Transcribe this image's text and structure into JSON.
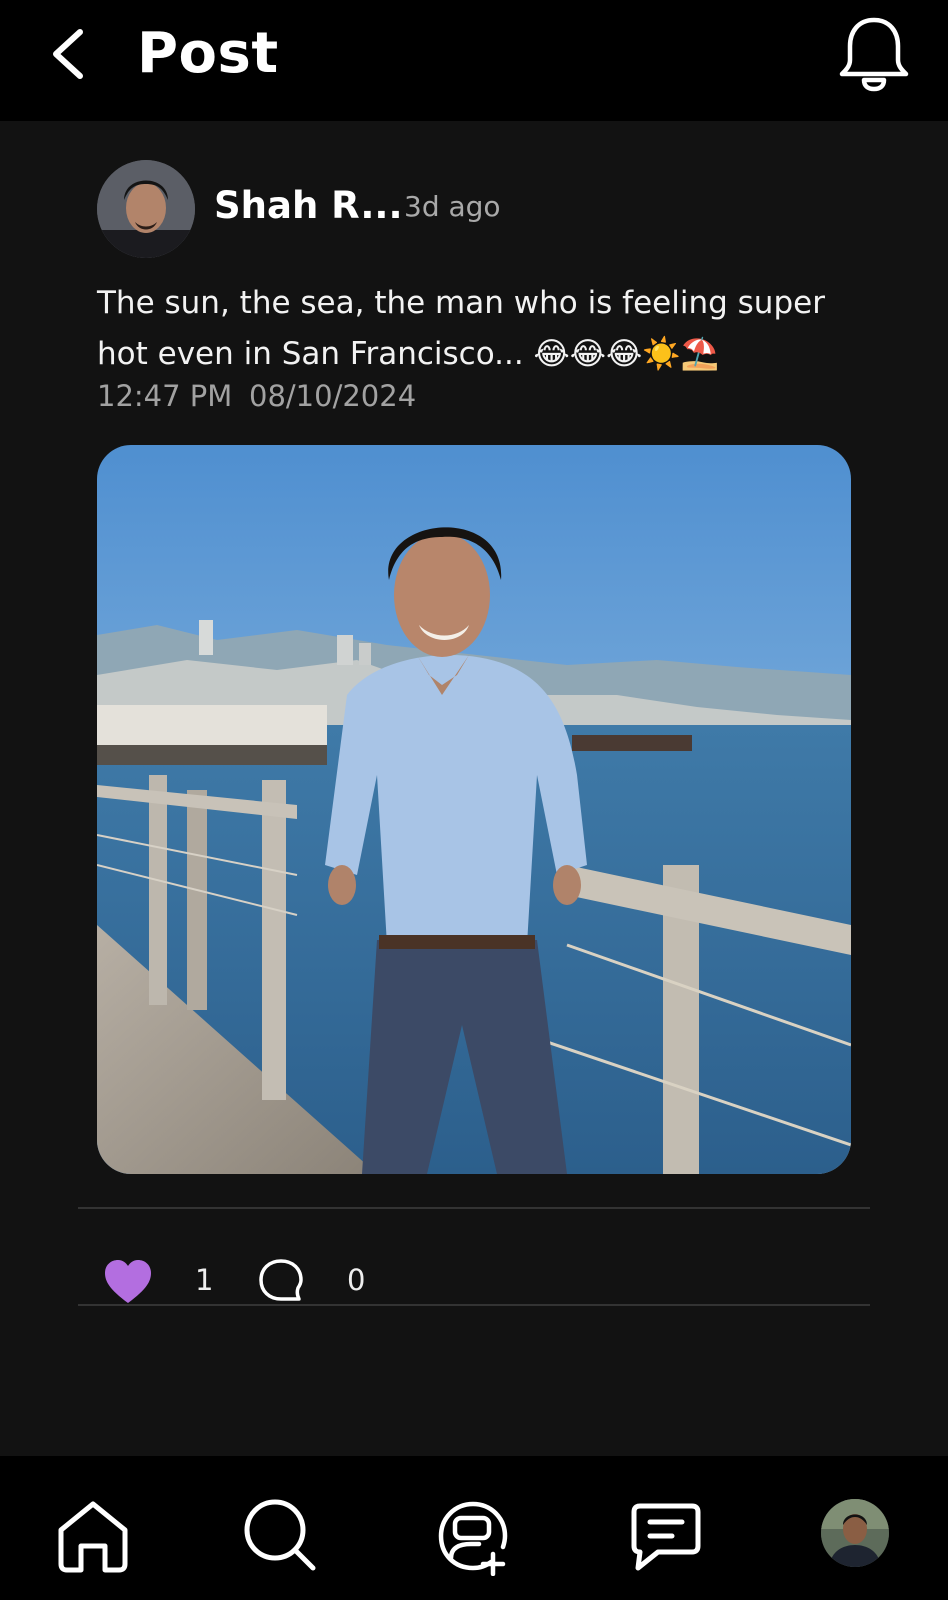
{
  "header": {
    "title": "Post",
    "back_icon": "chevron-left-icon",
    "notifications_icon": "bell-icon"
  },
  "post": {
    "author_name": "Shah R...",
    "time_ago": "3d ago",
    "text_line1": "The sun, the sea, the man who is feeling super",
    "text_line2": "hot even in San Francisco... 😂😂😂☀️⛱️",
    "time": "12:47 PM",
    "date": "08/10/2024",
    "image_alt": "Man in light blue shirt smiling on a wooden pier with San Francisco bay behind",
    "likes": "1",
    "comments": "0",
    "like_icon": "heart-icon",
    "comment_icon": "comment-bubble-icon",
    "like_color": "#b36ee0"
  },
  "bottom_nav": {
    "items": [
      {
        "name": "home",
        "icon": "home-icon"
      },
      {
        "name": "search",
        "icon": "search-icon"
      },
      {
        "name": "create",
        "icon": "add-chat-icon"
      },
      {
        "name": "messages",
        "icon": "message-icon"
      },
      {
        "name": "profile",
        "icon": "profile-avatar"
      }
    ]
  }
}
